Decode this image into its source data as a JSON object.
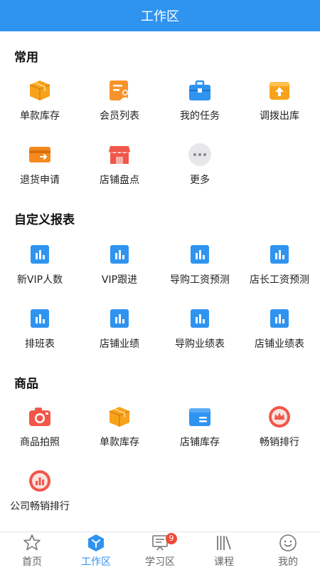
{
  "header": {
    "title": "工作区"
  },
  "sections": {
    "common": {
      "title": "常用",
      "items": [
        {
          "label": "单款库存",
          "icon": "box-icon"
        },
        {
          "label": "会员列表",
          "icon": "member-list-icon"
        },
        {
          "label": "我的任务",
          "icon": "briefcase-icon"
        },
        {
          "label": "调拨出库",
          "icon": "transfer-out-icon"
        },
        {
          "label": "退货申请",
          "icon": "return-request-icon"
        },
        {
          "label": "店铺盘点",
          "icon": "store-icon"
        },
        {
          "label": "更多",
          "icon": "more-icon"
        }
      ]
    },
    "reports": {
      "title": "自定义报表",
      "items": [
        {
          "label": "新VIP人数",
          "icon": "report-chart-icon"
        },
        {
          "label": "VIP跟进",
          "icon": "report-chart-icon"
        },
        {
          "label": "导购工资预测",
          "icon": "report-chart-icon"
        },
        {
          "label": "店长工资预测",
          "icon": "report-chart-icon"
        },
        {
          "label": "排班表",
          "icon": "report-chart-icon"
        },
        {
          "label": "店铺业绩",
          "icon": "report-chart-icon"
        },
        {
          "label": "导购业绩表",
          "icon": "report-chart-icon"
        },
        {
          "label": "店铺业绩表",
          "icon": "report-chart-icon"
        }
      ]
    },
    "goods": {
      "title": "商品",
      "items": [
        {
          "label": "商品拍照",
          "icon": "camera-icon"
        },
        {
          "label": "单款库存",
          "icon": "box-icon"
        },
        {
          "label": "店铺库存",
          "icon": "store-inventory-icon"
        },
        {
          "label": "畅销排行",
          "icon": "crown-badge-icon"
        },
        {
          "label": "公司畅销排行",
          "icon": "company-ranking-icon"
        }
      ]
    }
  },
  "tabbar": {
    "items": [
      {
        "label": "首页",
        "icon": "home-icon"
      },
      {
        "label": "工作区",
        "icon": "workspace-icon"
      },
      {
        "label": "学习区",
        "icon": "study-icon",
        "badge": "9"
      },
      {
        "label": "课程",
        "icon": "course-icon"
      },
      {
        "label": "我的",
        "icon": "profile-icon"
      }
    ]
  },
  "colors": {
    "primary": "#2f93f0",
    "orange": "#f7a21b",
    "red": "#f0574a",
    "badge": "#f04a3a"
  }
}
